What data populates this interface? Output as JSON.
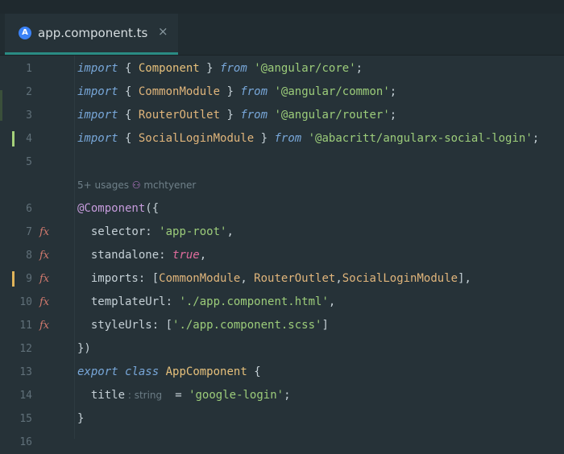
{
  "tab": {
    "icon_letter": "A",
    "filename": "app.component.ts",
    "close": "×"
  },
  "hints": {
    "usages": "5+ usages",
    "author": "mchtyener",
    "type_hint": ": string"
  },
  "lines": [
    {
      "n": "1",
      "tokens": [
        [
          "kw",
          "import"
        ],
        [
          "plain",
          " { "
        ],
        [
          "cls",
          "Component"
        ],
        [
          "plain",
          " } "
        ],
        [
          "kw",
          "from"
        ],
        [
          "plain",
          " "
        ],
        [
          "str",
          "'@angular/core'"
        ],
        [
          "plain",
          ";"
        ]
      ]
    },
    {
      "n": "2",
      "tokens": [
        [
          "kw",
          "import"
        ],
        [
          "plain",
          " { "
        ],
        [
          "cls2",
          "CommonModule"
        ],
        [
          "plain",
          " } "
        ],
        [
          "kw",
          "from"
        ],
        [
          "plain",
          " "
        ],
        [
          "str",
          "'@angular/common'"
        ],
        [
          "plain",
          ";"
        ]
      ]
    },
    {
      "n": "3",
      "tokens": [
        [
          "kw",
          "import"
        ],
        [
          "plain",
          " { "
        ],
        [
          "cls2",
          "RouterOutlet"
        ],
        [
          "plain",
          " } "
        ],
        [
          "kw",
          "from"
        ],
        [
          "plain",
          " "
        ],
        [
          "str",
          "'@angular/router'"
        ],
        [
          "plain",
          ";"
        ]
      ]
    },
    {
      "n": "4",
      "tokens": [
        [
          "kw",
          "import"
        ],
        [
          "plain",
          " { "
        ],
        [
          "cls2",
          "SocialLoginModule"
        ],
        [
          "plain",
          " } "
        ],
        [
          "kw",
          "from"
        ],
        [
          "plain",
          " "
        ],
        [
          "str",
          "'@abacritt/angularx-social-login'"
        ],
        [
          "plain",
          ";"
        ]
      ]
    },
    {
      "n": "5",
      "tokens": []
    },
    {
      "n": "6",
      "tokens": [
        [
          "deco",
          "@Component"
        ],
        [
          "plain",
          "({"
        ]
      ]
    },
    {
      "n": "7",
      "tokens": [
        [
          "prop",
          "  selector"
        ],
        [
          "plain",
          ": "
        ],
        [
          "str",
          "'app-root'"
        ],
        [
          "plain",
          ","
        ]
      ]
    },
    {
      "n": "8",
      "tokens": [
        [
          "prop",
          "  standalone"
        ],
        [
          "plain",
          ": "
        ],
        [
          "bool",
          "true"
        ],
        [
          "plain",
          ","
        ]
      ]
    },
    {
      "n": "9",
      "tokens": [
        [
          "prop",
          "  imports"
        ],
        [
          "plain",
          ": ["
        ],
        [
          "cls2",
          "CommonModule"
        ],
        [
          "plain",
          ", "
        ],
        [
          "cls2",
          "RouterOutlet"
        ],
        [
          "plain",
          ","
        ],
        [
          "cls2",
          "SocialLoginModule"
        ],
        [
          "plain",
          "],"
        ]
      ]
    },
    {
      "n": "10",
      "tokens": [
        [
          "prop",
          "  templateUrl"
        ],
        [
          "plain",
          ": "
        ],
        [
          "str",
          "'./app.component.html'"
        ],
        [
          "plain",
          ","
        ]
      ]
    },
    {
      "n": "11",
      "tokens": [
        [
          "prop",
          "  styleUrls"
        ],
        [
          "plain",
          ": ["
        ],
        [
          "str",
          "'./app.component.scss'"
        ],
        [
          "plain",
          "]"
        ]
      ]
    },
    {
      "n": "12",
      "tokens": [
        [
          "plain",
          "})"
        ]
      ]
    },
    {
      "n": "13",
      "tokens": [
        [
          "kw",
          "export"
        ],
        [
          "plain",
          " "
        ],
        [
          "kw",
          "class"
        ],
        [
          "plain",
          " "
        ],
        [
          "cls",
          "AppComponent"
        ],
        [
          "plain",
          " {"
        ]
      ]
    },
    {
      "n": "14",
      "tokens": [
        [
          "prop",
          "  title"
        ],
        [
          "hint",
          " : string  "
        ],
        [
          "plain",
          " = "
        ],
        [
          "str",
          "'google-login'"
        ],
        [
          "plain",
          ";"
        ]
      ]
    },
    {
      "n": "15",
      "tokens": [
        [
          "plain",
          "}"
        ]
      ]
    },
    {
      "n": "16",
      "tokens": []
    }
  ],
  "colors": {
    "background": "#263238",
    "accent": "#2a8c84",
    "added_marker": "#a5d17a",
    "modified_marker": "#e0b45a"
  }
}
